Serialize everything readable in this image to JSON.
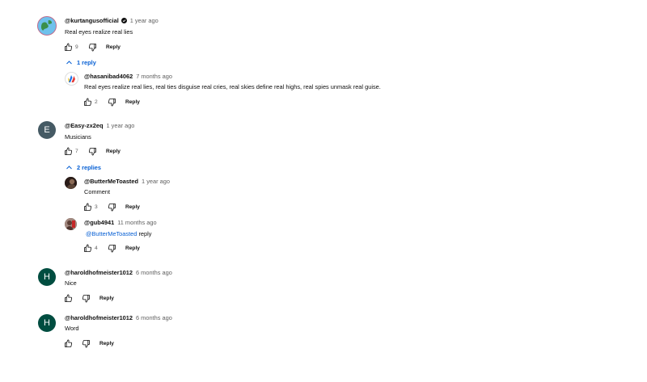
{
  "comments": [
    {
      "author": "@kurtangusofficial",
      "time": "1 year ago",
      "text": "Real eyes realize real lies",
      "likes": "9",
      "reply_label": "Reply",
      "replies_toggle": "1 reply",
      "replies": [
        {
          "author": "@hasanibad4062",
          "time": "7 months ago",
          "text": "Real eyes realize real lies, real ties disguise real cries, real skies define real highs, real spies unmask real guise.",
          "likes": "2",
          "reply_label": "Reply"
        }
      ]
    },
    {
      "author": "@Easy-zx2eq",
      "avatar_letter": "E",
      "time": "1 year ago",
      "text": "Musicians",
      "likes": "7",
      "reply_label": "Reply",
      "replies_toggle": "2 replies",
      "replies": [
        {
          "author": "@ButterMeToasted",
          "time": "1 year ago",
          "text": "Comment",
          "likes": "3",
          "reply_label": "Reply"
        },
        {
          "author": "@gub4941",
          "time": "11 months ago",
          "mention": "@ButterMeToasted",
          "text": "reply",
          "likes": "4",
          "reply_label": "Reply"
        }
      ]
    },
    {
      "author": "@haroldhofmeister1012",
      "avatar_letter": "H",
      "time": "6 months ago",
      "text": "Nice",
      "reply_label": "Reply"
    },
    {
      "author": "@haroldhofmeister1012",
      "avatar_letter": "H",
      "time": "6 months ago",
      "text": "Word",
      "reply_label": "Reply"
    }
  ],
  "colors": {
    "link": "#065fd4",
    "muted": "#606060",
    "avatar_e": "#455a64",
    "avatar_h": "#004d40"
  }
}
